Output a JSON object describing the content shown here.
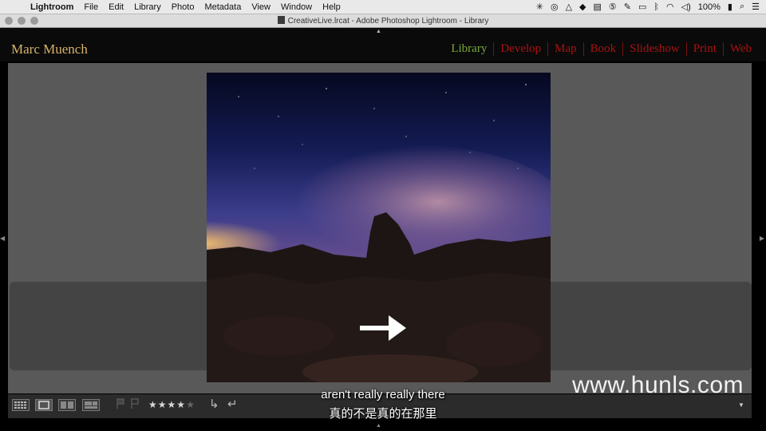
{
  "menubar": {
    "apple": "",
    "items": [
      "Lightroom",
      "File",
      "Edit",
      "Library",
      "Photo",
      "Metadata",
      "View",
      "Window",
      "Help"
    ],
    "battery": "100%"
  },
  "window": {
    "title": "CreativeLive.lrcat - Adobe Photoshop Lightroom - Library"
  },
  "identity_plate": "Marc Muench",
  "modules": [
    "Library",
    "Develop",
    "Map",
    "Book",
    "Slideshow",
    "Print",
    "Web"
  ],
  "active_module": "Library",
  "toolbar": {
    "rating_stars": 4,
    "stars_text": "★★★★★"
  },
  "subtitle": {
    "english": "aren't really really there",
    "chinese": "真的不是真的在那里"
  },
  "watermark": "www.hunls.com"
}
